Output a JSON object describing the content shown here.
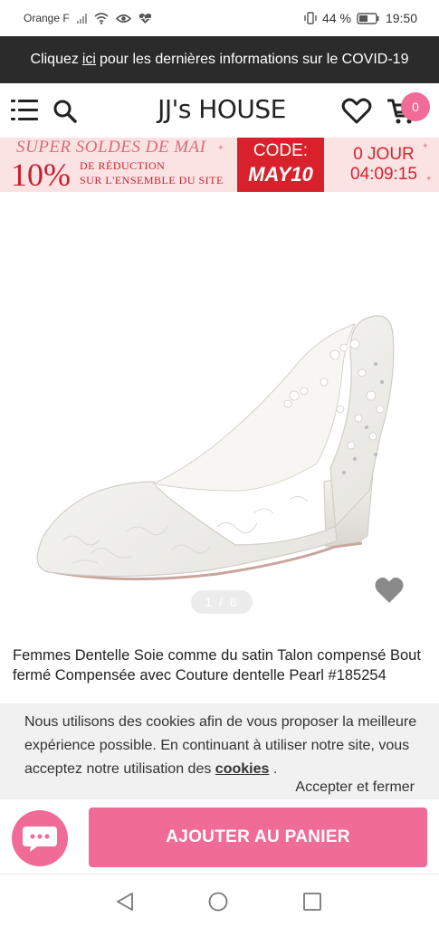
{
  "status_bar": {
    "carrier": "Orange F",
    "battery": "44 %",
    "time": "19:50"
  },
  "covid_banner": {
    "prefix": "Cliquez",
    "link": "ici",
    "suffix": "pour les dernières informations sur le COVID-19"
  },
  "header": {
    "logo": "JJ's HOUSE",
    "cart_count": "0"
  },
  "promo": {
    "title": "SUPER SOLDES DE MAI",
    "percent": "10%",
    "line1": "DE RÉDUCTION",
    "line2": "SUR L'ENSEMBLE DU SITE",
    "code_label": "CODE:",
    "code_value": "MAY10",
    "countdown_days": "0 JOUR",
    "countdown_time": "04:09:15"
  },
  "product": {
    "pager": "1 / 6",
    "title": "Femmes Dentelle Soie comme du satin Talon compensé Bout fermé Compensée avec Couture dentelle Pearl #185254"
  },
  "cookie_notice": {
    "text": "Nous utilisons des cookies afin de vous proposer la meilleure expérience possible. En continuant à utiliser notre site, vous acceptez notre utilisation des",
    "link": "cookies",
    "end": ".",
    "accept": "Accepter et fermer"
  },
  "actions": {
    "add_to_cart": "AJOUTER AU PANIER"
  },
  "colors": {
    "accent_pink": "#f06b96",
    "promo_red": "#d9212c",
    "banner_dark": "#2b2b2b"
  },
  "icons": [
    "wifi-icon",
    "eye-icon",
    "heart-pulse-icon",
    "vibrate-icon",
    "battery-icon",
    "menu-icon",
    "search-icon",
    "heart-icon",
    "cart-icon",
    "chat-icon",
    "back-icon",
    "home-icon",
    "recent-apps-icon"
  ]
}
